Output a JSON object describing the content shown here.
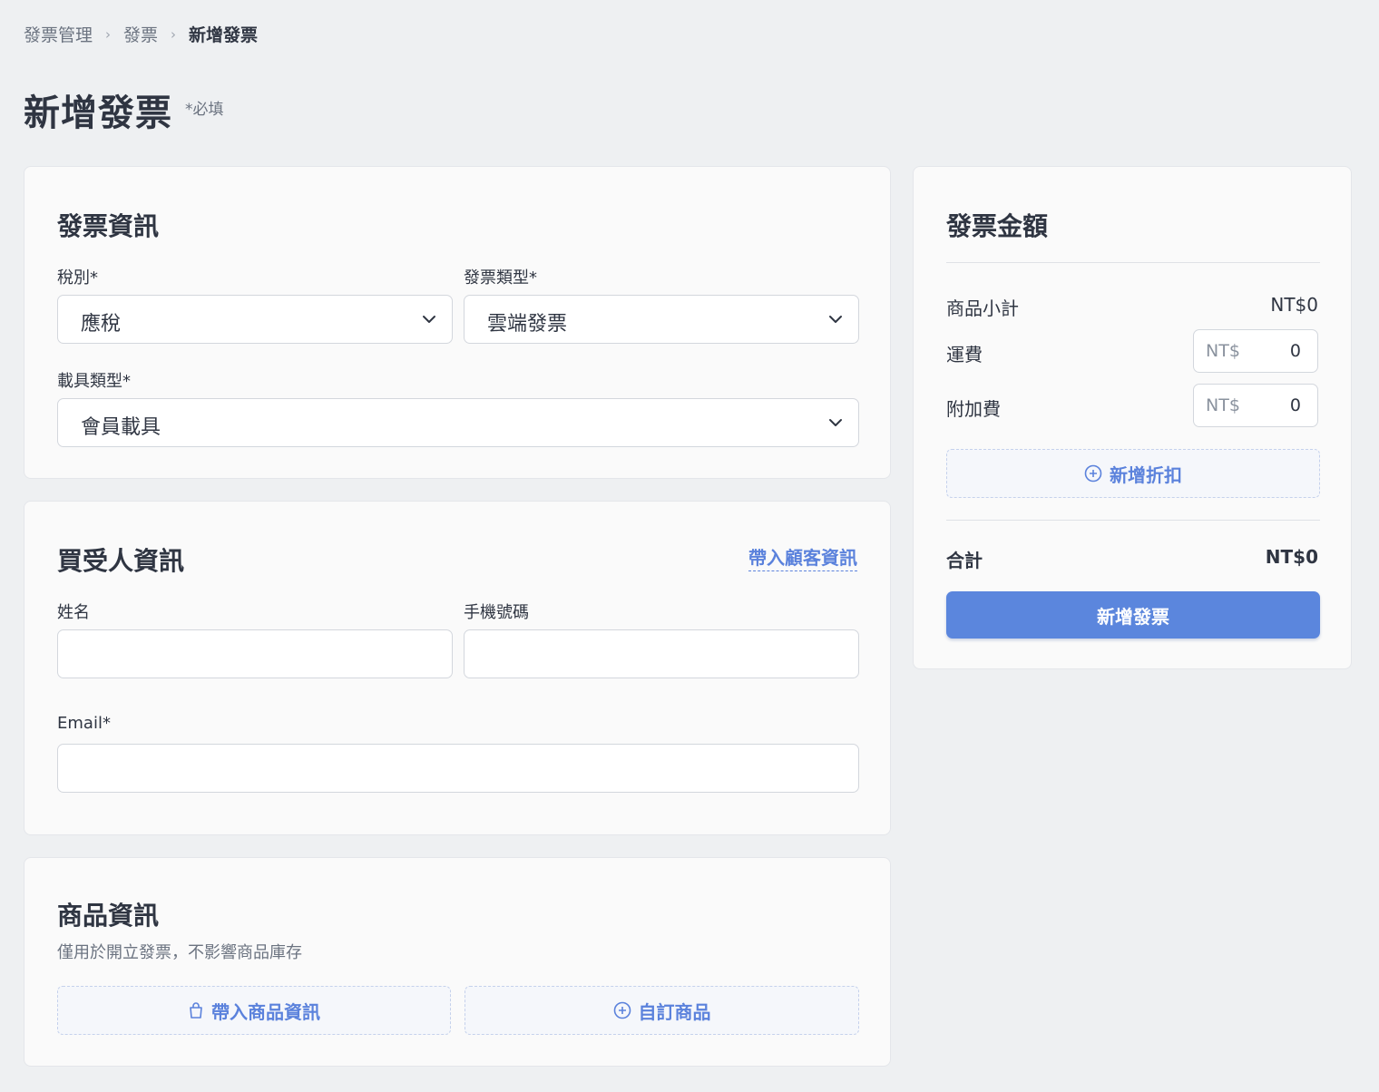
{
  "breadcrumb": {
    "items": [
      "發票管理",
      "發票",
      "新增發票"
    ]
  },
  "header": {
    "title": "新增發票",
    "required_note": "*必填"
  },
  "invoice_info": {
    "title": "發票資訊",
    "tax_type": {
      "label": "稅別*",
      "value": "應稅"
    },
    "invoice_type": {
      "label": "發票類型*",
      "value": "雲端發票"
    },
    "carrier_type": {
      "label": "載具類型*",
      "value": "會員載具"
    }
  },
  "buyer_info": {
    "title": "買受人資訊",
    "import_link": "帶入顧客資訊",
    "name": {
      "label": "姓名",
      "value": ""
    },
    "phone": {
      "label": "手機號碼",
      "value": ""
    },
    "email": {
      "label": "Email*",
      "value": ""
    }
  },
  "product_info": {
    "title": "商品資訊",
    "subtitle": "僅用於開立發票，不影響商品庫存",
    "import_button": "帶入商品資訊",
    "custom_button": "自訂商品"
  },
  "amount": {
    "title": "發票金額",
    "subtotal_label": "商品小計",
    "subtotal_value": "NT$0",
    "shipping_label": "運費",
    "shipping_prefix": "NT$",
    "shipping_value": "0",
    "surcharge_label": "附加費",
    "surcharge_prefix": "NT$",
    "surcharge_value": "0",
    "add_discount": "新增折扣",
    "total_label": "合計",
    "total_value": "NT$0",
    "submit_button": "新增發票"
  },
  "colors": {
    "accent": "#5b86dd",
    "link": "#5b82dc",
    "background": "#eef0f2"
  }
}
